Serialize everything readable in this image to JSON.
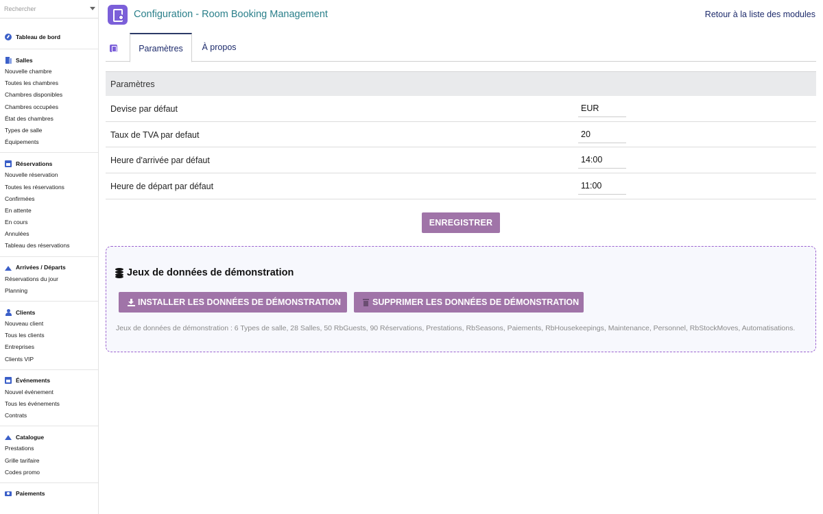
{
  "search": {
    "placeholder": "Rechercher"
  },
  "sidebar": {
    "dashboard": {
      "label": "Tableau de bord",
      "icon": "gauge-icon"
    },
    "groups": [
      {
        "title": "Salles",
        "icon": "door-icon",
        "items": [
          "Nouvelle chambre",
          "Toutes les chambres",
          "Chambres disponibles",
          "Chambres occupées",
          "État des chambres",
          "Types de salle",
          "Équipements"
        ]
      },
      {
        "title": "Réservations",
        "icon": "calendar-icon",
        "items": [
          "Nouvelle réservation",
          "Toutes les réservations",
          "Confirmées",
          "En attente",
          "En cours",
          "Annulées",
          "Tableau des réservations"
        ]
      },
      {
        "title": "Arrivées / Départs",
        "icon": "plane-icon",
        "items": [
          "Réservations du jour",
          "Planning"
        ]
      },
      {
        "title": "Clients",
        "icon": "user-icon",
        "items": [
          "Nouveau client",
          "Tous les clients",
          "Entreprises",
          "Clients VIP"
        ]
      },
      {
        "title": "Événements",
        "icon": "calendar-icon",
        "items": [
          "Nouvel événement",
          "Tous les événements",
          "Contrats"
        ]
      },
      {
        "title": "Catalogue",
        "icon": "plane-icon",
        "items": [
          "Prestations",
          "Grille tarifaire",
          "Codes promo"
        ]
      },
      {
        "title": "Paiements",
        "icon": "money-icon",
        "items": []
      }
    ]
  },
  "header": {
    "title": "Configuration - Room Booking Management",
    "back_link": "Retour à la liste des modules"
  },
  "tabs": [
    {
      "label": "Paramètres",
      "active": true
    },
    {
      "label": "À propos",
      "active": false
    }
  ],
  "settings": {
    "section_title": "Paramètres",
    "rows": [
      {
        "label": "Devise par défaut",
        "value": "EUR"
      },
      {
        "label": "Taux de TVA par defaut",
        "value": "20"
      },
      {
        "label": "Heure d'arrivée par défaut",
        "value": "14:00"
      },
      {
        "label": "Heure de départ par défaut",
        "value": "11:00"
      }
    ],
    "save_label": "ENREGISTRER"
  },
  "demo": {
    "title": "Jeux de données de démonstration",
    "install_label": "INSTALLER LES DONNÉES DE DÉMONSTRATION",
    "delete_label": "SUPPRIMER LES DONNÉES DE DÉMONSTRATION",
    "description": "Jeux de données de démonstration : 6 Types de salle, 28 Salles, 50 RbGuests, 90 Réservations, Prestations, RbSeasons, Paiements, RbHousekeepings, Maintenance, Personnel, RbStockMoves, Automatisations."
  },
  "colors": {
    "accent_button": "#a074a8",
    "title_teal": "#2a7f8a",
    "link_navy": "#1c2a6b",
    "icon_blue": "#3b5fc8",
    "logo_purple": "#7b5fd9",
    "demo_border": "#9a5fcf"
  }
}
